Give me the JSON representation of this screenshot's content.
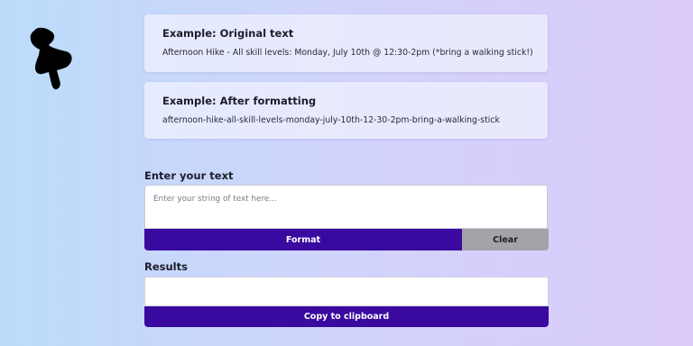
{
  "decoration": {
    "pin_icon": "pushpin-icon",
    "pin_color": "#000000"
  },
  "examples": {
    "original": {
      "title": "Example: Original text",
      "text": "Afternoon Hike - All skill levels: Monday, July 10th @ 12:30-2pm (*bring a walking stick!)"
    },
    "formatted": {
      "title": "Example: After formatting",
      "text": "afternoon-hike-all-skill-levels-monday-july-10th-12-30-2pm-bring-a-walking-stick"
    }
  },
  "input": {
    "label": "Enter your text",
    "placeholder": "Enter your string of text here...",
    "value": ""
  },
  "actions": {
    "format_label": "Format",
    "clear_label": "Clear",
    "copy_label": "Copy to clipboard"
  },
  "results": {
    "label": "Results",
    "value": ""
  },
  "colors": {
    "primary_button": "#3a0aa0",
    "secondary_button": "#a3a3a8",
    "background_start": "#bcdcfb",
    "background_end": "#dccbfb"
  }
}
